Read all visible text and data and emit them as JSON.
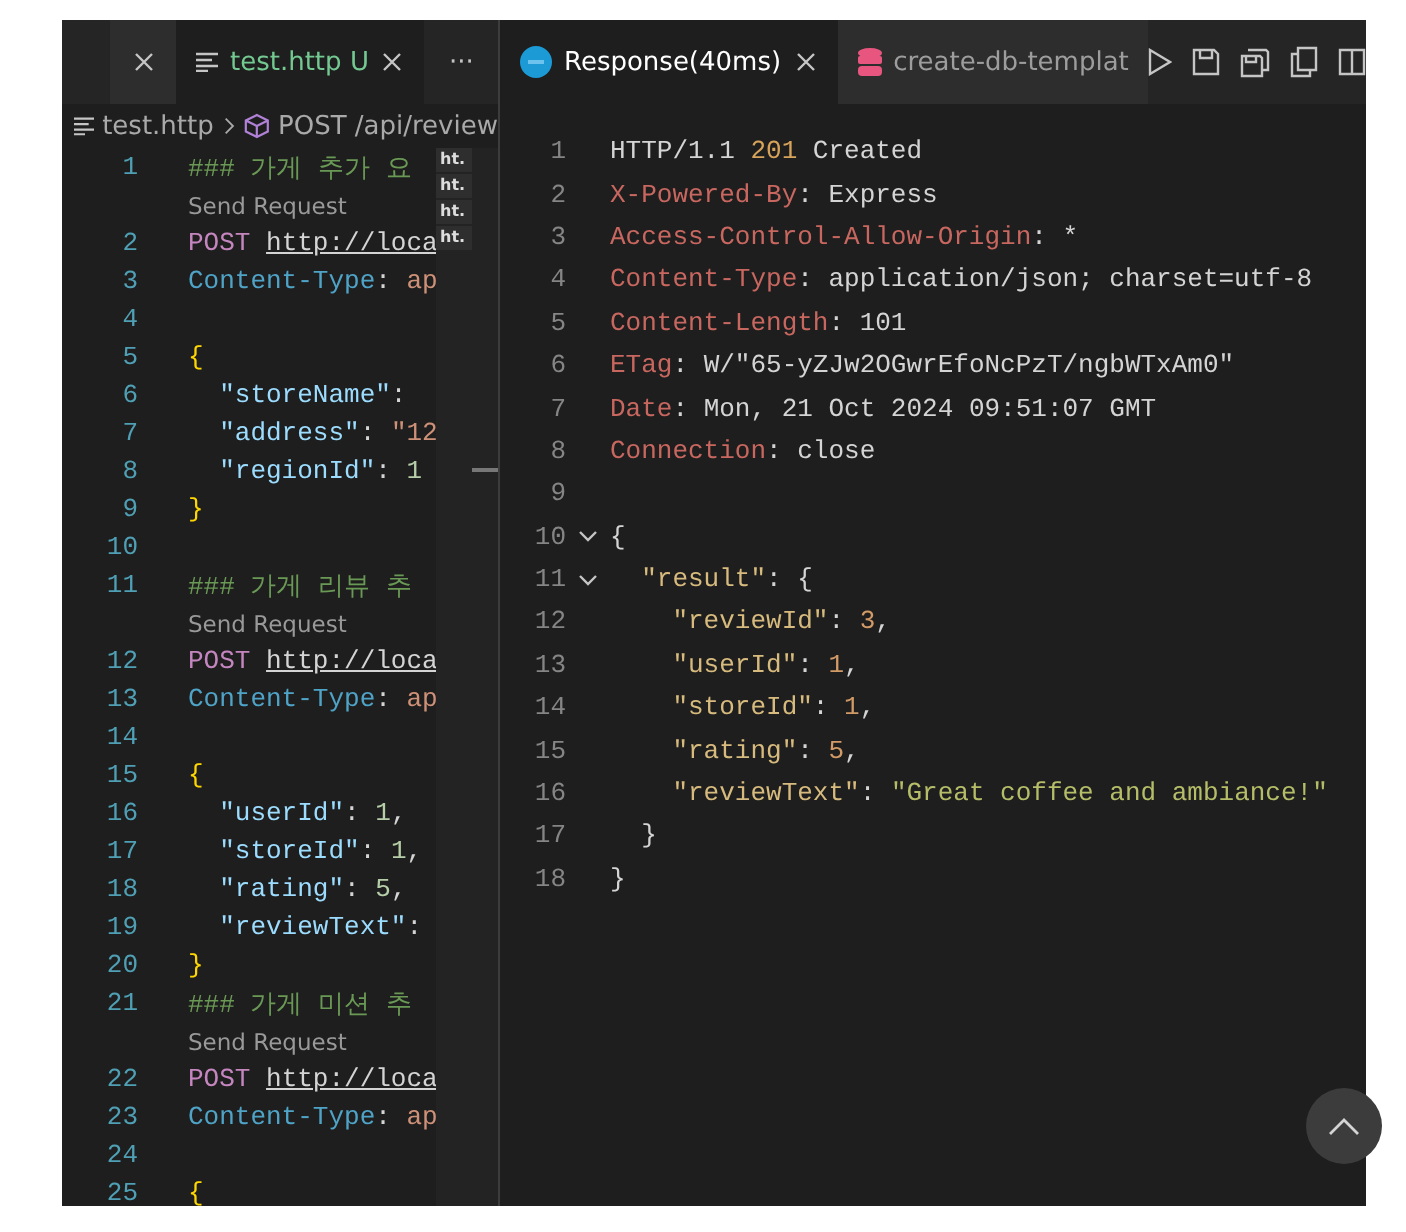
{
  "left_pane": {
    "tabs": [
      {
        "label": "test.http",
        "status": "U",
        "selected": true
      }
    ],
    "more": "···",
    "breadcrumb": {
      "file": "test.http",
      "symbol": "POST /api/review"
    },
    "lines": [
      {
        "kind": "code",
        "number": "1",
        "tokens": [
          {
            "kind": "comment",
            "text": "### 가게 추가 요"
          }
        ]
      },
      {
        "kind": "codelens",
        "text": "Send Request"
      },
      {
        "kind": "code",
        "number": "2",
        "tokens": [
          {
            "kind": "keyword",
            "text": "POST "
          },
          {
            "kind": "url",
            "text": "http://loca"
          }
        ]
      },
      {
        "kind": "code",
        "number": "3",
        "tokens": [
          {
            "kind": "header",
            "text": "Content-Type"
          },
          {
            "kind": "punct",
            "text": ": "
          },
          {
            "kind": "value",
            "text": "ap"
          }
        ]
      },
      {
        "kind": "code",
        "number": "4"
      },
      {
        "kind": "code",
        "number": "5",
        "tokens": [
          {
            "kind": "brace",
            "text": "{"
          }
        ]
      },
      {
        "kind": "code",
        "number": "6",
        "tokens": [
          {
            "kind": "key",
            "text": "  \"storeName\""
          },
          {
            "kind": "punct",
            "text": ": "
          }
        ]
      },
      {
        "kind": "code",
        "number": "7",
        "tokens": [
          {
            "kind": "key",
            "text": "  \"address\""
          },
          {
            "kind": "punct",
            "text": ": "
          },
          {
            "kind": "value",
            "text": "\"12"
          }
        ]
      },
      {
        "kind": "code",
        "number": "8",
        "tokens": [
          {
            "kind": "key",
            "text": "  \"regionId\""
          },
          {
            "kind": "punct",
            "text": ": "
          },
          {
            "kind": "number",
            "text": "1"
          }
        ]
      },
      {
        "kind": "code",
        "number": "9",
        "tokens": [
          {
            "kind": "brace",
            "text": "}"
          }
        ]
      },
      {
        "kind": "code",
        "number": "10"
      },
      {
        "kind": "code",
        "number": "11",
        "tokens": [
          {
            "kind": "comment",
            "text": "### 가게 리뷰 추"
          }
        ]
      },
      {
        "kind": "codelens",
        "text": "Send Request"
      },
      {
        "kind": "code",
        "number": "12",
        "tokens": [
          {
            "kind": "keyword",
            "text": "POST "
          },
          {
            "kind": "url",
            "text": "http://loca"
          }
        ]
      },
      {
        "kind": "code",
        "number": "13",
        "tokens": [
          {
            "kind": "header",
            "text": "Content-Type"
          },
          {
            "kind": "punct",
            "text": ": "
          },
          {
            "kind": "value",
            "text": "ap"
          }
        ]
      },
      {
        "kind": "code",
        "number": "14"
      },
      {
        "kind": "code",
        "number": "15",
        "tokens": [
          {
            "kind": "brace",
            "text": "{"
          }
        ]
      },
      {
        "kind": "code",
        "number": "16",
        "tokens": [
          {
            "kind": "key",
            "text": "  \"userId\""
          },
          {
            "kind": "punct",
            "text": ": "
          },
          {
            "kind": "number",
            "text": "1"
          },
          {
            "kind": "punct",
            "text": ","
          }
        ]
      },
      {
        "kind": "code",
        "number": "17",
        "tokens": [
          {
            "kind": "key",
            "text": "  \"storeId\""
          },
          {
            "kind": "punct",
            "text": ": "
          },
          {
            "kind": "number",
            "text": "1"
          },
          {
            "kind": "punct",
            "text": ","
          }
        ]
      },
      {
        "kind": "code",
        "number": "18",
        "tokens": [
          {
            "kind": "key",
            "text": "  \"rating\""
          },
          {
            "kind": "punct",
            "text": ": "
          },
          {
            "kind": "number",
            "text": "5"
          },
          {
            "kind": "punct",
            "text": ","
          }
        ]
      },
      {
        "kind": "code",
        "number": "19",
        "tokens": [
          {
            "kind": "key",
            "text": "  \"reviewText\""
          },
          {
            "kind": "punct",
            "text": ":"
          }
        ]
      },
      {
        "kind": "code",
        "number": "20",
        "tokens": [
          {
            "kind": "brace",
            "text": "}"
          }
        ]
      },
      {
        "kind": "code",
        "number": "21",
        "tokens": [
          {
            "kind": "comment",
            "text": "### 가게 미션 추"
          }
        ]
      },
      {
        "kind": "codelens",
        "text": "Send Request"
      },
      {
        "kind": "code",
        "number": "22",
        "tokens": [
          {
            "kind": "keyword",
            "text": "POST "
          },
          {
            "kind": "url",
            "text": "http://loca"
          }
        ]
      },
      {
        "kind": "code",
        "number": "23",
        "tokens": [
          {
            "kind": "header",
            "text": "Content-Type"
          },
          {
            "kind": "punct",
            "text": ": "
          },
          {
            "kind": "value",
            "text": "ap"
          }
        ]
      },
      {
        "kind": "code",
        "number": "24"
      },
      {
        "kind": "code",
        "number": "25",
        "tokens": [
          {
            "kind": "brace",
            "text": "{"
          }
        ]
      }
    ],
    "minimap": [
      "ht.",
      "ht.",
      "ht.",
      "ht."
    ]
  },
  "right_pane": {
    "tabs": [
      {
        "label": "Response(40ms)",
        "kind": "response",
        "selected": true
      },
      {
        "label": "create-db-templat",
        "kind": "database",
        "selected": false
      }
    ],
    "lines": [
      {
        "number": "1",
        "tokens": [
          {
            "kind": "text",
            "text": "HTTP/1.1 "
          },
          {
            "kind": "status",
            "text": "201"
          },
          {
            "kind": "text",
            "text": " Created"
          }
        ]
      },
      {
        "number": "2",
        "tokens": [
          {
            "kind": "header",
            "text": "X-Powered-By"
          },
          {
            "kind": "text",
            "text": ": Express"
          }
        ]
      },
      {
        "number": "3",
        "tokens": [
          {
            "kind": "header",
            "text": "Access-Control-Allow-Origin"
          },
          {
            "kind": "text",
            "text": ": *"
          }
        ]
      },
      {
        "number": "4",
        "tokens": [
          {
            "kind": "header",
            "text": "Content-Type"
          },
          {
            "kind": "text",
            "text": ": application/json; charset=utf-8"
          }
        ]
      },
      {
        "number": "5",
        "tokens": [
          {
            "kind": "header",
            "text": "Content-Length"
          },
          {
            "kind": "text",
            "text": ": 101"
          }
        ]
      },
      {
        "number": "6",
        "tokens": [
          {
            "kind": "header",
            "text": "ETag"
          },
          {
            "kind": "text",
            "text": ": W/\"65-yZJw2OGwrEfoNcPzT/ngbWTxAm0\""
          }
        ]
      },
      {
        "number": "7",
        "tokens": [
          {
            "kind": "header",
            "text": "Date"
          },
          {
            "kind": "text",
            "text": ": Mon, 21 Oct 2024 09:51:07 GMT"
          }
        ]
      },
      {
        "number": "8",
        "tokens": [
          {
            "kind": "header",
            "text": "Connection"
          },
          {
            "kind": "text",
            "text": ": close"
          }
        ]
      },
      {
        "number": "9"
      },
      {
        "number": "10",
        "expanded": true,
        "tokens": [
          {
            "kind": "punct",
            "text": "{"
          }
        ]
      },
      {
        "number": "11",
        "expanded": true,
        "tokens": [
          {
            "kind": "key",
            "text": "  \"result\""
          },
          {
            "kind": "punct",
            "text": ": {"
          }
        ]
      },
      {
        "number": "12",
        "tokens": [
          {
            "kind": "key",
            "text": "    \"reviewId\""
          },
          {
            "kind": "punct",
            "text": ": "
          },
          {
            "kind": "number",
            "text": "3"
          },
          {
            "kind": "punct",
            "text": ","
          }
        ]
      },
      {
        "number": "13",
        "tokens": [
          {
            "kind": "key",
            "text": "    \"userId\""
          },
          {
            "kind": "punct",
            "text": ": "
          },
          {
            "kind": "number",
            "text": "1"
          },
          {
            "kind": "punct",
            "text": ","
          }
        ]
      },
      {
        "number": "14",
        "tokens": [
          {
            "kind": "key",
            "text": "    \"storeId\""
          },
          {
            "kind": "punct",
            "text": ": "
          },
          {
            "kind": "number",
            "text": "1"
          },
          {
            "kind": "punct",
            "text": ","
          }
        ]
      },
      {
        "number": "15",
        "tokens": [
          {
            "kind": "key",
            "text": "    \"rating\""
          },
          {
            "kind": "punct",
            "text": ": "
          },
          {
            "kind": "number",
            "text": "5"
          },
          {
            "kind": "punct",
            "text": ","
          }
        ]
      },
      {
        "number": "16",
        "tokens": [
          {
            "kind": "key",
            "text": "    \"reviewText\""
          },
          {
            "kind": "punct",
            "text": ": "
          },
          {
            "kind": "string",
            "text": "\"Great coffee and ambiance!\""
          }
        ]
      },
      {
        "number": "17",
        "tokens": [
          {
            "kind": "punct",
            "text": "  }"
          }
        ]
      },
      {
        "number": "18",
        "tokens": [
          {
            "kind": "punct",
            "text": "}"
          }
        ]
      }
    ]
  }
}
